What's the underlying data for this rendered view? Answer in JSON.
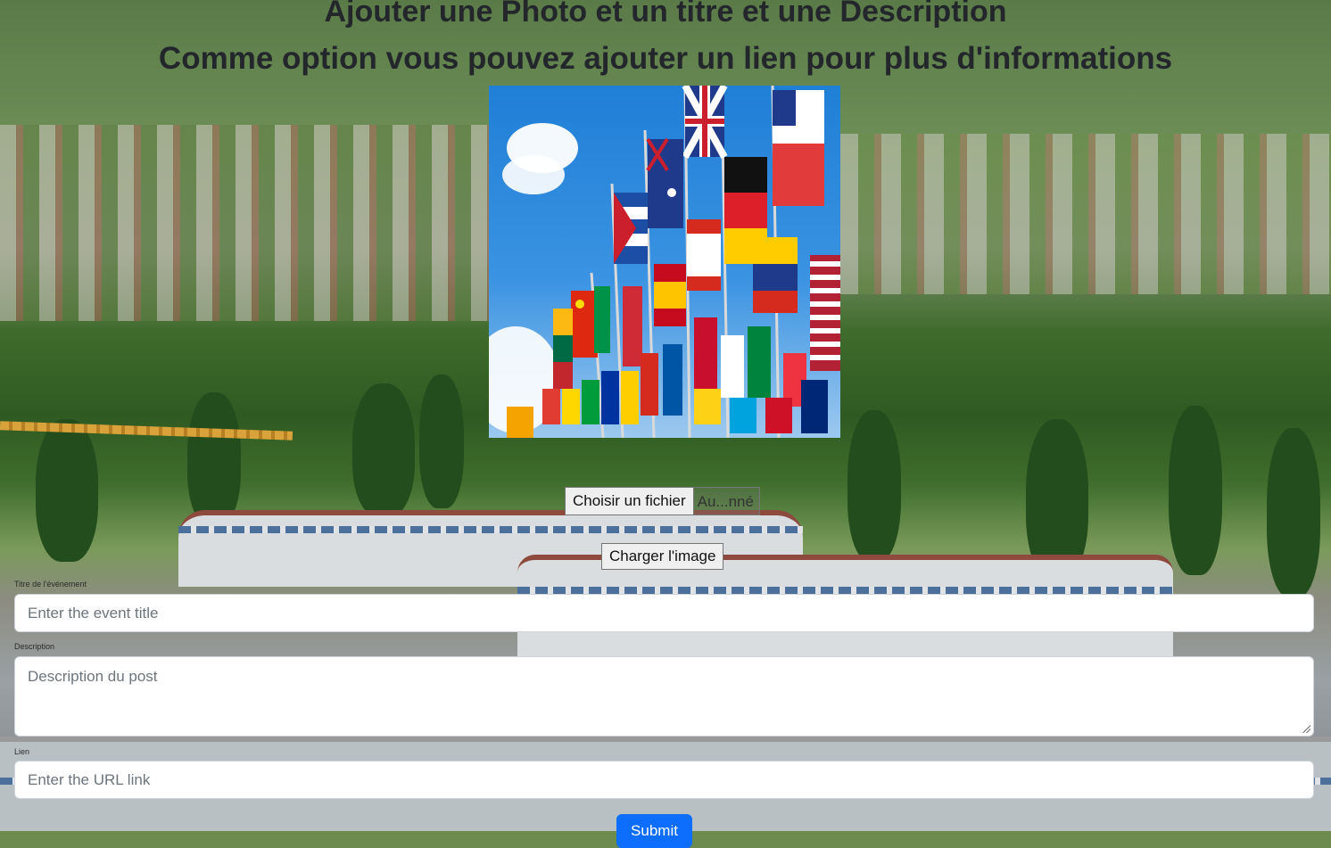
{
  "header": {
    "title_line1": "Ajouter une Photo et un titre et une Description",
    "title_line2": "Comme option vous pouvez ajouter un lien pour plus d'informations"
  },
  "image_preview": {
    "icon": "flags-photo"
  },
  "upload": {
    "choose_file_label": "Choisir un fichier",
    "file_status": "Au...nné",
    "upload_button_label": "Charger l'image"
  },
  "form": {
    "title_label": "Titre de l'événement",
    "title_placeholder": "Enter the event title",
    "description_label": "Description",
    "description_placeholder": "Description du post",
    "link_label": "Lien",
    "link_placeholder": "Enter the URL link",
    "submit_label": "Submit"
  },
  "colors": {
    "primary": "#0d6efd",
    "title_text": "#23272b"
  }
}
